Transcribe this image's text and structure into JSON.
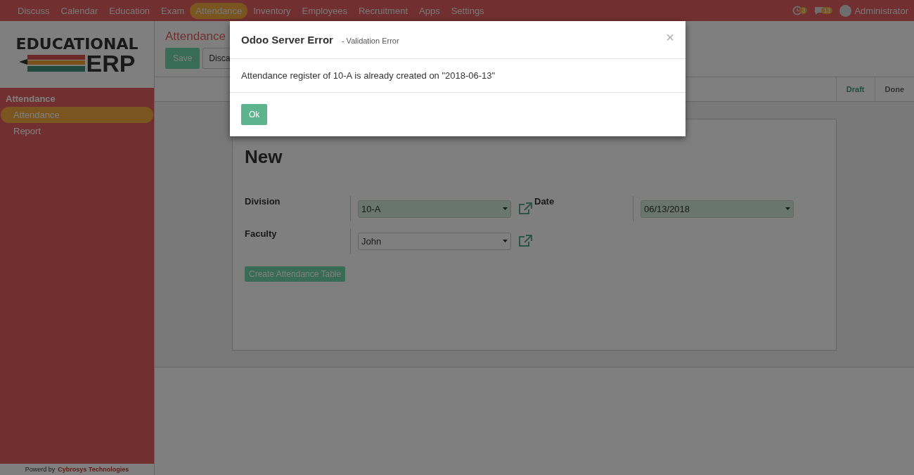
{
  "top_nav": {
    "items": [
      {
        "label": "Discuss",
        "selected": false
      },
      {
        "label": "Calendar",
        "selected": false
      },
      {
        "label": "Education",
        "selected": false
      },
      {
        "label": "Exam",
        "selected": false
      },
      {
        "label": "Attendance",
        "selected": true
      },
      {
        "label": "Inventory",
        "selected": false
      },
      {
        "label": "Employees",
        "selected": false
      },
      {
        "label": "Recruitment",
        "selected": false
      },
      {
        "label": "Apps",
        "selected": false
      },
      {
        "label": "Settings",
        "selected": false
      }
    ],
    "activity_count": "3",
    "message_count": "13",
    "user": "Administrator"
  },
  "logo": {
    "line1": "EDUCATIONAL",
    "line2": "ERP"
  },
  "sidebar": {
    "section": "Attendance",
    "items": [
      {
        "label": "Attendance",
        "selected": true
      },
      {
        "label": "Report",
        "selected": false
      }
    ],
    "footer": {
      "prefix": "Powerd by",
      "link": "Cybrosys Technologies"
    }
  },
  "control_panel": {
    "breadcrumb": "Attendance",
    "save": "Save",
    "discard": "Disca"
  },
  "status_bar": [
    {
      "label": "Draft",
      "selected": true
    },
    {
      "label": "Done",
      "selected": false
    }
  ],
  "form": {
    "title": "New",
    "left_fields": [
      {
        "label": "Division",
        "value": "10-A",
        "required": true
      },
      {
        "label": "Faculty",
        "value": "John",
        "required": false
      }
    ],
    "right_fields": [
      {
        "label": "Date",
        "value": "06/13/2018",
        "required": true
      }
    ],
    "action_button": "Create Attendance Table"
  },
  "dialog": {
    "title": "Odoo Server Error",
    "subtitle": "- Validation Error",
    "close": "×",
    "message": "Attendance register of 10-A is already created on \"2018-06-13\"",
    "ok": "Ok"
  }
}
